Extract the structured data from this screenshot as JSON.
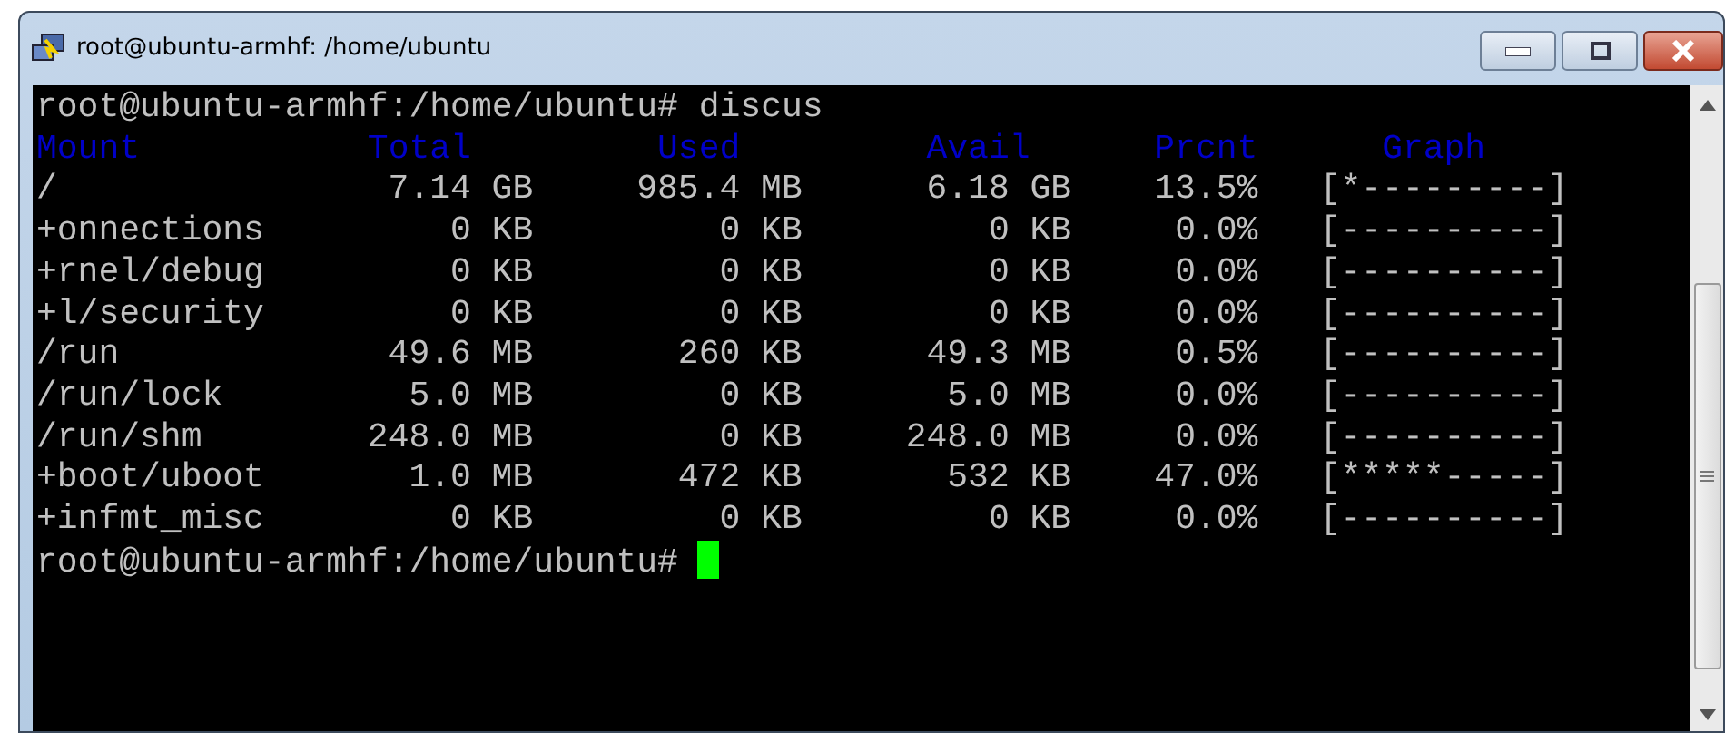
{
  "window": {
    "title": "root@ubuntu-armhf: /home/ubuntu"
  },
  "terminal": {
    "command_line": "root@ubuntu-armhf:/home/ubuntu# discus",
    "columns": [
      "Mount",
      "Total",
      "Used",
      "Avail",
      "Prcnt",
      "Graph"
    ],
    "rows": [
      {
        "mount": "/",
        "total": "7.14 GB",
        "used": "985.4 MB",
        "avail": "6.18 GB",
        "prcnt": "13.5%",
        "graph": "[*---------]"
      },
      {
        "mount": "+onnections",
        "total": "0 KB",
        "used": "0 KB",
        "avail": "0 KB",
        "prcnt": "0.0%",
        "graph": "[----------]"
      },
      {
        "mount": "+rnel/debug",
        "total": "0 KB",
        "used": "0 KB",
        "avail": "0 KB",
        "prcnt": "0.0%",
        "graph": "[----------]"
      },
      {
        "mount": "+l/security",
        "total": "0 KB",
        "used": "0 KB",
        "avail": "0 KB",
        "prcnt": "0.0%",
        "graph": "[----------]"
      },
      {
        "mount": "/run",
        "total": "49.6 MB",
        "used": "260 KB",
        "avail": "49.3 MB",
        "prcnt": "0.5%",
        "graph": "[----------]"
      },
      {
        "mount": "/run/lock",
        "total": "5.0 MB",
        "used": "0 KB",
        "avail": "5.0 MB",
        "prcnt": "0.0%",
        "graph": "[----------]"
      },
      {
        "mount": "/run/shm",
        "total": "248.0 MB",
        "used": "0 KB",
        "avail": "248.0 MB",
        "prcnt": "0.0%",
        "graph": "[----------]"
      },
      {
        "mount": "+boot/uboot",
        "total": "1.0 MB",
        "used": "472 KB",
        "avail": "532 KB",
        "prcnt": "47.0%",
        "graph": "[*****-----]"
      },
      {
        "mount": "+infmt_misc",
        "total": "0 KB",
        "used": "0 KB",
        "avail": "0 KB",
        "prcnt": "0.0%",
        "graph": "[----------]"
      }
    ],
    "prompt": "root@ubuntu-armhf:/home/ubuntu#"
  }
}
